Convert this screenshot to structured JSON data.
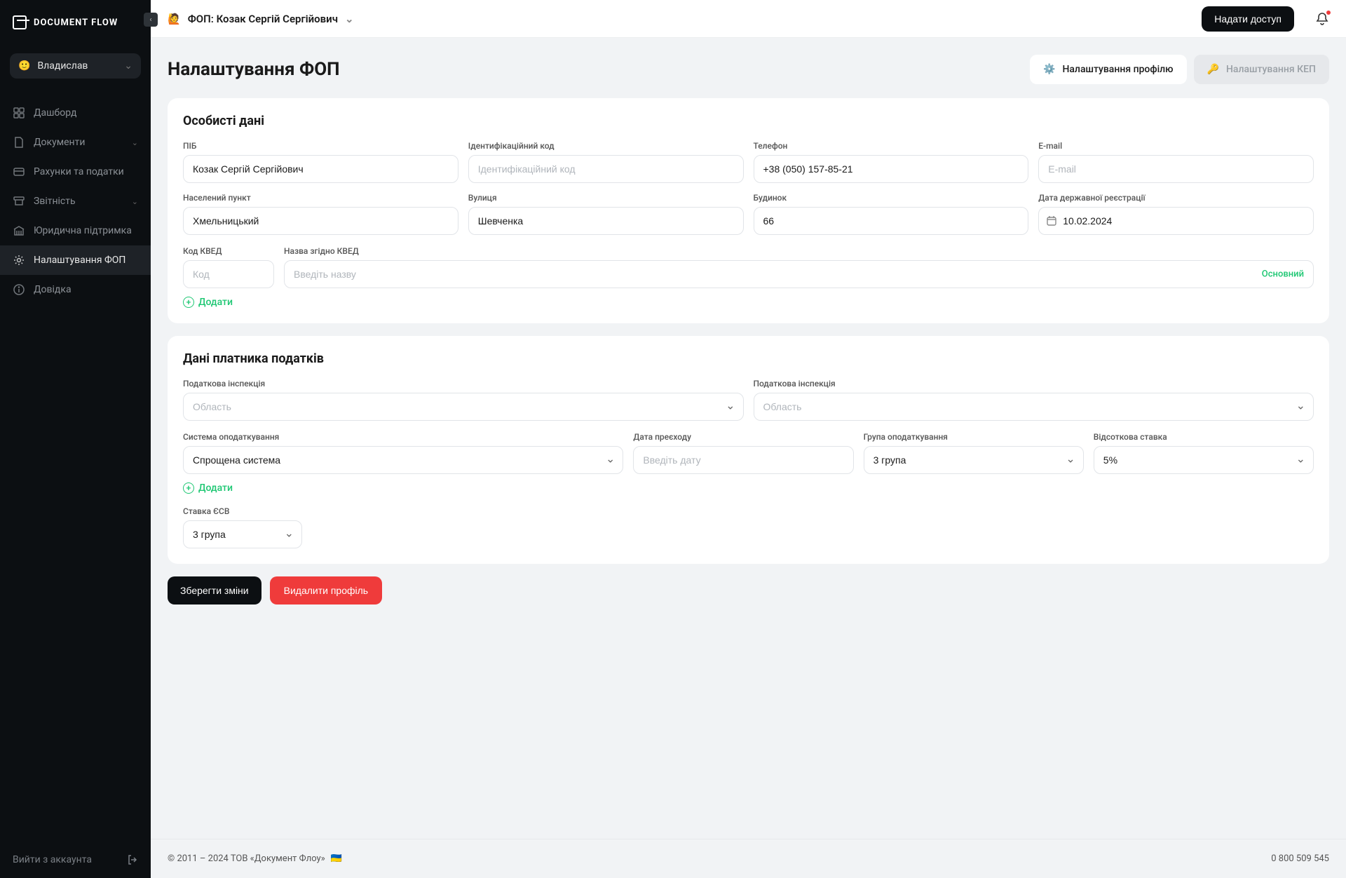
{
  "brand": "DOCUMENT FLOW",
  "user": {
    "name": "Владислав",
    "avatar": "🙂"
  },
  "nav": {
    "dashboard": "Дашборд",
    "documents": "Документи",
    "invoices": "Рахунки та податки",
    "reports": "Звітність",
    "legal": "Юридична підтримка",
    "settings": "Налаштування ФОП",
    "help": "Довідка"
  },
  "logout": "Вийти з аккаунта",
  "topbar": {
    "profile_emoji": "🙋",
    "profile_name": "ФОП: Козак Сергій Сергійович",
    "grant_access": "Надати доступ"
  },
  "page": {
    "title": "Налаштування ФОП",
    "tab_profile": "Налаштування профілю",
    "tab_kep": "Налаштування КЕП",
    "gear_emoji": "⚙️",
    "key_emoji": "🔑"
  },
  "sections": {
    "personal_title": "Особисті дані",
    "tax_title": "Дані платника податків"
  },
  "labels": {
    "pib": "ПІБ",
    "inn": "Ідентифікаційний код",
    "phone": "Телефон",
    "email": "E-mail",
    "city": "Населений пункт",
    "street": "Вулиця",
    "house": "Будинок",
    "regdate": "Дата державної реєстрації",
    "kved_code": "Код КВЕД",
    "kved_name": "Назва згідно КВЕД",
    "tax_inspection": "Податкова інспекція",
    "tax_system": "Система оподаткування",
    "transition_date": "Дата преєходу",
    "tax_group": "Група оподаткування",
    "rate": "Відсоткова ставка",
    "esv_rate": "Ставка ЄСВ"
  },
  "placeholders": {
    "inn": "Ідентифікаційний код",
    "email": "E-mail",
    "kved_code": "Код",
    "kved_name": "Введіть назву",
    "oblast": "Область",
    "enter_date": "Введіть дату"
  },
  "values": {
    "pib": "Козак Сергій Сергійович",
    "phone": "+38 (050) 157-85-21",
    "city": "Хмельницький",
    "street": "Шевченка",
    "house": "66",
    "regdate": "10.02.2024",
    "tax_system": "Спрощена система",
    "tax_group": "3 група",
    "rate": "5%",
    "esv": "3 група"
  },
  "kved_primary": "Основний",
  "add": "Додати",
  "actions": {
    "save": "Зберегти зміни",
    "delete": "Видалити профіль"
  },
  "footer": {
    "copyright": "© 2011 – 2024 ТОВ «Документ Флоу»",
    "flag": "🇺🇦",
    "phone": "0 800 509 545"
  }
}
